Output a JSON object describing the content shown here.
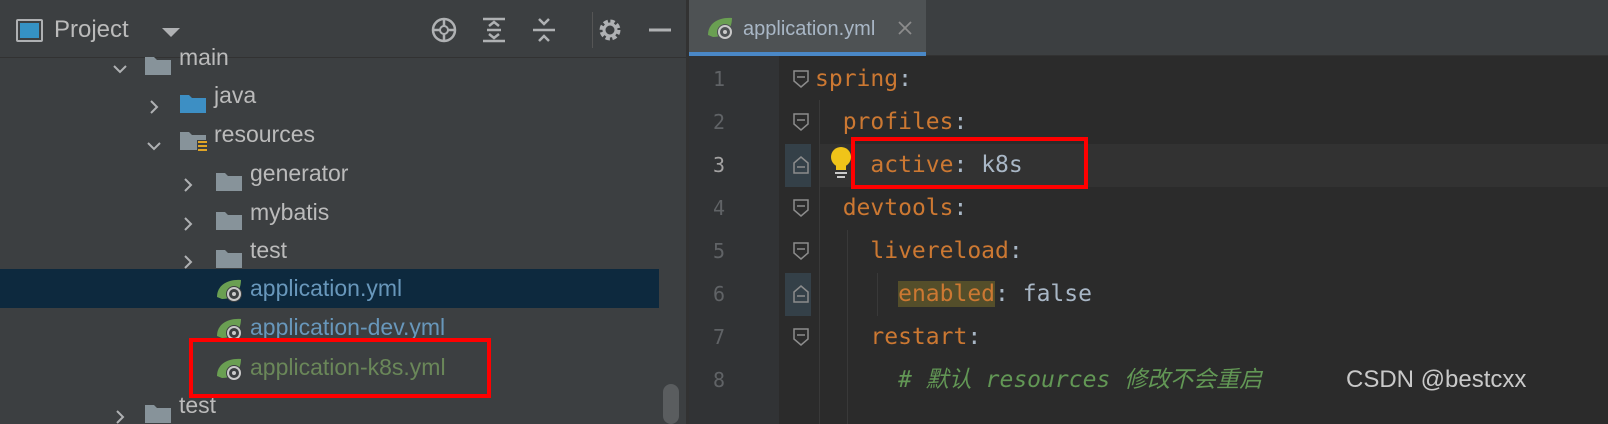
{
  "project_panel": {
    "title": "Project",
    "tree": [
      {
        "label": "main",
        "kind": "folder",
        "expanded": true
      },
      {
        "label": "java",
        "kind": "source-folder",
        "expanded": false
      },
      {
        "label": "resources",
        "kind": "resources-folder",
        "expanded": true
      },
      {
        "label": "generator",
        "kind": "folder",
        "expanded": false
      },
      {
        "label": "mybatis",
        "kind": "folder",
        "expanded": false
      },
      {
        "label": "test",
        "kind": "folder",
        "expanded": false
      },
      {
        "label": "application.yml",
        "kind": "yml",
        "selected": true
      },
      {
        "label": "application-dev.yml",
        "kind": "yml"
      },
      {
        "label": "application-k8s.yml",
        "kind": "yml"
      },
      {
        "label": "test",
        "kind": "folder",
        "expanded": false
      }
    ],
    "toolbar_icons": [
      "locate-icon",
      "expand-all-icon",
      "collapse-all-icon",
      "gear-icon",
      "hide-icon"
    ]
  },
  "editor": {
    "tab_label": "application.yml",
    "line_numbers": [
      "1",
      "2",
      "3",
      "4",
      "5",
      "6",
      "7",
      "8"
    ],
    "current_line": "3",
    "lines": [
      {
        "key": "spring",
        "sep": ":",
        "value": ""
      },
      {
        "key": "profiles",
        "sep": ":",
        "value": ""
      },
      {
        "key": "active",
        "sep": ":",
        "value": " k8s"
      },
      {
        "key": "devtools",
        "sep": ":",
        "value": ""
      },
      {
        "key": "livereload",
        "sep": ":",
        "value": ""
      },
      {
        "key": "enabled",
        "sep": ":",
        "value": " false"
      },
      {
        "key": "restart",
        "sep": ":",
        "value": ""
      },
      {
        "comment": "# 默认 resources 修改不会重启"
      }
    ]
  },
  "watermark": "CSDN @bestcxx",
  "colors": {
    "panel_bg": "#3c3f41",
    "editor_bg": "#2b2b2b",
    "selection": "#0d293e",
    "accent": "#4a88c7",
    "yaml_key": "#cc7832",
    "comment": "#629755",
    "annotation_red": "#ff0000",
    "yml_modified": "#6a8759"
  }
}
